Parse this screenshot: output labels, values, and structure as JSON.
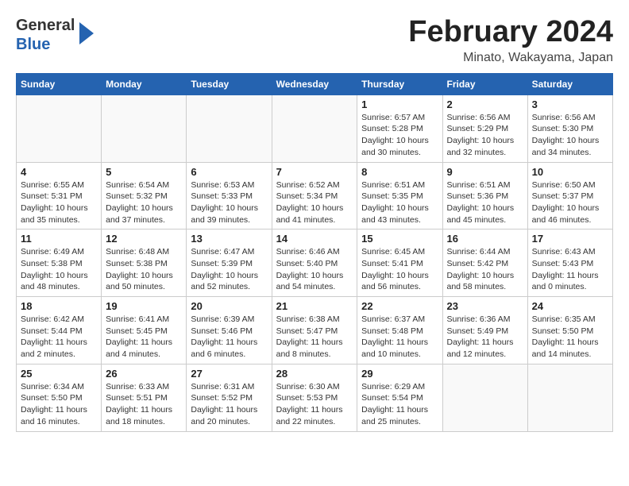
{
  "logo": {
    "line1": "General",
    "line2": "Blue"
  },
  "title": "February 2024",
  "location": "Minato, Wakayama, Japan",
  "weekdays": [
    "Sunday",
    "Monday",
    "Tuesday",
    "Wednesday",
    "Thursday",
    "Friday",
    "Saturday"
  ],
  "weeks": [
    [
      {
        "day": "",
        "info": ""
      },
      {
        "day": "",
        "info": ""
      },
      {
        "day": "",
        "info": ""
      },
      {
        "day": "",
        "info": ""
      },
      {
        "day": "1",
        "info": "Sunrise: 6:57 AM\nSunset: 5:28 PM\nDaylight: 10 hours and 30 minutes."
      },
      {
        "day": "2",
        "info": "Sunrise: 6:56 AM\nSunset: 5:29 PM\nDaylight: 10 hours and 32 minutes."
      },
      {
        "day": "3",
        "info": "Sunrise: 6:56 AM\nSunset: 5:30 PM\nDaylight: 10 hours and 34 minutes."
      }
    ],
    [
      {
        "day": "4",
        "info": "Sunrise: 6:55 AM\nSunset: 5:31 PM\nDaylight: 10 hours and 35 minutes."
      },
      {
        "day": "5",
        "info": "Sunrise: 6:54 AM\nSunset: 5:32 PM\nDaylight: 10 hours and 37 minutes."
      },
      {
        "day": "6",
        "info": "Sunrise: 6:53 AM\nSunset: 5:33 PM\nDaylight: 10 hours and 39 minutes."
      },
      {
        "day": "7",
        "info": "Sunrise: 6:52 AM\nSunset: 5:34 PM\nDaylight: 10 hours and 41 minutes."
      },
      {
        "day": "8",
        "info": "Sunrise: 6:51 AM\nSunset: 5:35 PM\nDaylight: 10 hours and 43 minutes."
      },
      {
        "day": "9",
        "info": "Sunrise: 6:51 AM\nSunset: 5:36 PM\nDaylight: 10 hours and 45 minutes."
      },
      {
        "day": "10",
        "info": "Sunrise: 6:50 AM\nSunset: 5:37 PM\nDaylight: 10 hours and 46 minutes."
      }
    ],
    [
      {
        "day": "11",
        "info": "Sunrise: 6:49 AM\nSunset: 5:38 PM\nDaylight: 10 hours and 48 minutes."
      },
      {
        "day": "12",
        "info": "Sunrise: 6:48 AM\nSunset: 5:38 PM\nDaylight: 10 hours and 50 minutes."
      },
      {
        "day": "13",
        "info": "Sunrise: 6:47 AM\nSunset: 5:39 PM\nDaylight: 10 hours and 52 minutes."
      },
      {
        "day": "14",
        "info": "Sunrise: 6:46 AM\nSunset: 5:40 PM\nDaylight: 10 hours and 54 minutes."
      },
      {
        "day": "15",
        "info": "Sunrise: 6:45 AM\nSunset: 5:41 PM\nDaylight: 10 hours and 56 minutes."
      },
      {
        "day": "16",
        "info": "Sunrise: 6:44 AM\nSunset: 5:42 PM\nDaylight: 10 hours and 58 minutes."
      },
      {
        "day": "17",
        "info": "Sunrise: 6:43 AM\nSunset: 5:43 PM\nDaylight: 11 hours and 0 minutes."
      }
    ],
    [
      {
        "day": "18",
        "info": "Sunrise: 6:42 AM\nSunset: 5:44 PM\nDaylight: 11 hours and 2 minutes."
      },
      {
        "day": "19",
        "info": "Sunrise: 6:41 AM\nSunset: 5:45 PM\nDaylight: 11 hours and 4 minutes."
      },
      {
        "day": "20",
        "info": "Sunrise: 6:39 AM\nSunset: 5:46 PM\nDaylight: 11 hours and 6 minutes."
      },
      {
        "day": "21",
        "info": "Sunrise: 6:38 AM\nSunset: 5:47 PM\nDaylight: 11 hours and 8 minutes."
      },
      {
        "day": "22",
        "info": "Sunrise: 6:37 AM\nSunset: 5:48 PM\nDaylight: 11 hours and 10 minutes."
      },
      {
        "day": "23",
        "info": "Sunrise: 6:36 AM\nSunset: 5:49 PM\nDaylight: 11 hours and 12 minutes."
      },
      {
        "day": "24",
        "info": "Sunrise: 6:35 AM\nSunset: 5:50 PM\nDaylight: 11 hours and 14 minutes."
      }
    ],
    [
      {
        "day": "25",
        "info": "Sunrise: 6:34 AM\nSunset: 5:50 PM\nDaylight: 11 hours and 16 minutes."
      },
      {
        "day": "26",
        "info": "Sunrise: 6:33 AM\nSunset: 5:51 PM\nDaylight: 11 hours and 18 minutes."
      },
      {
        "day": "27",
        "info": "Sunrise: 6:31 AM\nSunset: 5:52 PM\nDaylight: 11 hours and 20 minutes."
      },
      {
        "day": "28",
        "info": "Sunrise: 6:30 AM\nSunset: 5:53 PM\nDaylight: 11 hours and 22 minutes."
      },
      {
        "day": "29",
        "info": "Sunrise: 6:29 AM\nSunset: 5:54 PM\nDaylight: 11 hours and 25 minutes."
      },
      {
        "day": "",
        "info": ""
      },
      {
        "day": "",
        "info": ""
      }
    ]
  ]
}
